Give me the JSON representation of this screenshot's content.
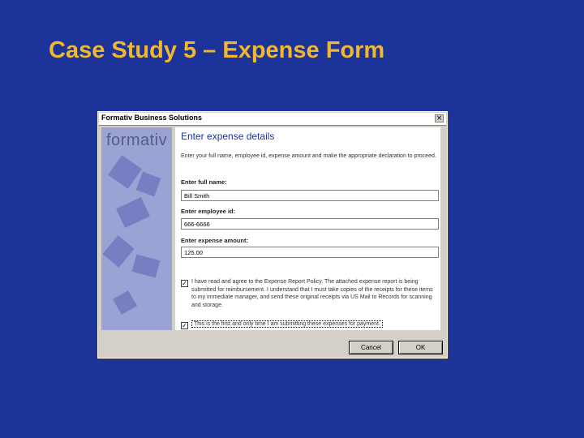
{
  "slide": {
    "title": "Case Study 5 – Expense Form"
  },
  "dialog": {
    "title": "Formativ Business Solutions",
    "close_glyph": "×",
    "brand": "formativ",
    "heading": "Enter expense details",
    "instructions": "Enter your full name, employee id, expense amount and make the appropriate declaration to proceed.",
    "fields": [
      {
        "label": "Enter full name:",
        "value": "Bill Smith"
      },
      {
        "label": "Enter employee id:",
        "value": "666-6666"
      },
      {
        "label": "Enter expense amount:",
        "value": "125.00"
      }
    ],
    "declarations": [
      {
        "checked": true,
        "check_glyph": "✓",
        "text": "I have read and agree to the Expense Report Policy. The attached expense report is being submitted for reimbursement. I understand that I must take copies of the receipts for these items to my immediate manager, and send these original receipts via US Mail to Records for scanning and storage."
      },
      {
        "checked": true,
        "check_glyph": "✓",
        "text": "This is the first and only time I am submitting these expenses for payment."
      }
    ],
    "buttons": {
      "cancel": "Cancel",
      "ok": "OK"
    }
  },
  "colors": {
    "slide_bg": "#1c3399",
    "title": "#f0b830",
    "dialog_face": "#d4d0c8",
    "side_panel": "#9aa3d4"
  }
}
